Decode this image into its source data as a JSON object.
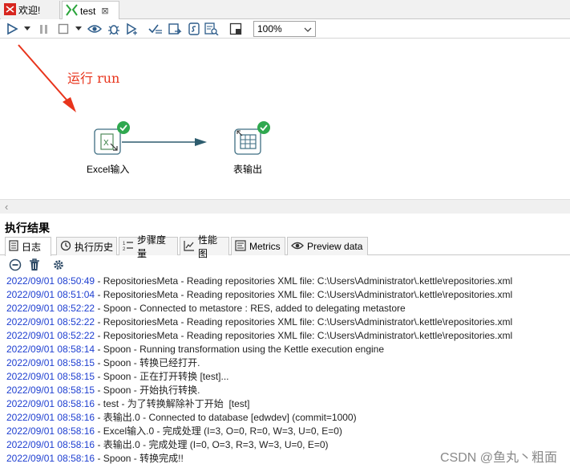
{
  "tabs": [
    {
      "label": "欢迎!",
      "icon": "kettle-logo-icon"
    },
    {
      "label": "test",
      "icon": "transformation-icon",
      "close": "⊠"
    }
  ],
  "toolbar": {
    "zoom": "100%",
    "icons": [
      "run-icon",
      "run-dropdown-icon",
      "pause-icon",
      "stop-icon",
      "stop-dropdown-icon",
      "preview-icon",
      "debug-icon",
      "replay-icon",
      "verify-icon",
      "analyze-impact-icon",
      "sql-icon",
      "explore-db-icon",
      "show-results-icon"
    ]
  },
  "canvas": {
    "annotation": "运行 run",
    "annotation_color": "#e8341c",
    "steps": [
      {
        "label": "Excel输入",
        "icon": "excel-input-icon",
        "status": "success"
      },
      {
        "label": "表输出",
        "icon": "table-output-icon",
        "status": "success"
      }
    ]
  },
  "results": {
    "title": "执行结果",
    "tabs": [
      {
        "label": "日志",
        "icon": "log-icon"
      },
      {
        "label": "执行历史",
        "icon": "history-icon"
      },
      {
        "label": "步骤度量",
        "icon": "step-metrics-icon"
      },
      {
        "label": "性能图",
        "icon": "performance-graph-icon"
      },
      {
        "label": "Metrics",
        "icon": "metrics-icon"
      },
      {
        "label": "Preview data",
        "icon": "preview-data-icon"
      }
    ],
    "tools": [
      "clear-log-icon",
      "delete-icon",
      "settings-icon"
    ],
    "log": [
      {
        "ts": "2022/09/01 08:50:49",
        "msg": " - RepositoriesMeta - Reading repositories XML file: C:\\Users\\Administrator\\.kettle\\repositories.xml"
      },
      {
        "ts": "2022/09/01 08:51:04",
        "msg": " - RepositoriesMeta - Reading repositories XML file: C:\\Users\\Administrator\\.kettle\\repositories.xml"
      },
      {
        "ts": "2022/09/01 08:52:22",
        "msg": " - Spoon - Connected to metastore : RES, added to delegating metastore"
      },
      {
        "ts": "2022/09/01 08:52:22",
        "msg": " - RepositoriesMeta - Reading repositories XML file: C:\\Users\\Administrator\\.kettle\\repositories.xml"
      },
      {
        "ts": "2022/09/01 08:52:22",
        "msg": " - RepositoriesMeta - Reading repositories XML file: C:\\Users\\Administrator\\.kettle\\repositories.xml"
      },
      {
        "ts": "2022/09/01 08:58:14",
        "msg": " - Spoon - Running transformation using the Kettle execution engine"
      },
      {
        "ts": "2022/09/01 08:58:15",
        "msg": " - Spoon - 转换已经打开."
      },
      {
        "ts": "2022/09/01 08:58:15",
        "msg": " - Spoon - 正在打开转换 [test]..."
      },
      {
        "ts": "2022/09/01 08:58:15",
        "msg": " - Spoon - 开始执行转换."
      },
      {
        "ts": "2022/09/01 08:58:16",
        "msg": " - test - 为了转换解除补丁开始  [test]"
      },
      {
        "ts": "2022/09/01 08:58:16",
        "msg": " - 表输出.0 - Connected to database [edwdev] (commit=1000)"
      },
      {
        "ts": "2022/09/01 08:58:16",
        "msg": " - Excel输入.0 - 完成处理 (I=3, O=0, R=0, W=3, U=0, E=0)"
      },
      {
        "ts": "2022/09/01 08:58:16",
        "msg": " - 表输出.0 - 完成处理 (I=0, O=3, R=3, W=3, U=0, E=0)"
      },
      {
        "ts": "2022/09/01 08:58:16",
        "msg": " - Spoon - 转换完成!!"
      }
    ]
  },
  "watermark": "CSDN @鱼丸丶粗面"
}
